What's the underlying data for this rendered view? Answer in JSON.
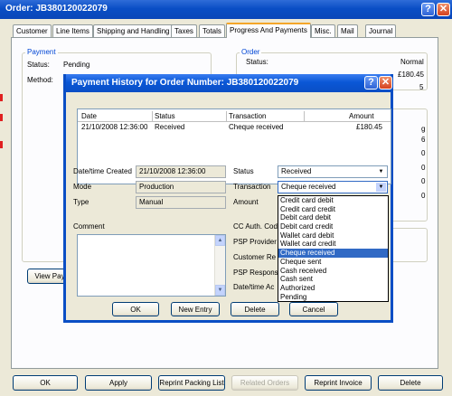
{
  "window": {
    "title": "Order: JB380120022079",
    "help_btn": "?",
    "close_btn": "✕"
  },
  "tabs": [
    "Customer",
    "Line Items",
    "Shipping and Handling",
    "Taxes",
    "Totals",
    "Progress And Payments",
    "Misc.",
    "Mail",
    "Journal"
  ],
  "active_tab": "Progress And Payments",
  "payment_group": {
    "legend": "Payment",
    "status_label": "Status:",
    "status_value": "Pending",
    "method_label": "Method:"
  },
  "order_group": {
    "legend": "Order",
    "status_label": "Status:",
    "status_value": "Normal",
    "clip_a": "£180.45",
    "clip_b": "5"
  },
  "right_clip": [
    "g",
    "6",
    "0",
    "0",
    "0",
    "0"
  ],
  "view_payments_btn": "View Pay",
  "bottom_buttons": {
    "ok": "OK",
    "apply": "Apply",
    "reprint_packing": "Reprint Packing List",
    "related_orders": "Related Orders",
    "reprint_invoice": "Reprint Invoice",
    "delete": "Delete"
  },
  "dialog": {
    "title": "Payment History for Order Number: JB380120022079",
    "help_btn": "?",
    "close_btn": "✕",
    "history": {
      "columns": [
        "Date",
        "Status",
        "Transaction",
        "Amount"
      ],
      "rows": [
        {
          "date": "21/10/2008 12:36:00",
          "status": "Received",
          "transaction": "Cheque received",
          "amount": "£180.45"
        }
      ]
    },
    "fields": {
      "datetime_label": "Date/time Created",
      "datetime_value": "21/10/2008 12:36:00",
      "mode_label": "Mode",
      "mode_value": "Production",
      "type_label": "Type",
      "type_value": "Manual",
      "status_label": "Status",
      "status_value": "Received",
      "transaction_label": "Transaction",
      "transaction_value": "Cheque received",
      "amount_label": "Amount",
      "comment_label": "Comment",
      "cc_auth_label": "CC Auth. Cod",
      "psp_provider_label": "PSP Provider",
      "customer_ref_label": "Customer Re",
      "psp_response_label": "PSP Respons",
      "datetime_ack_label": "Date/time Ac"
    },
    "transaction_options": [
      "Credit card debit",
      "Credit card credit",
      "Debit card debit",
      "Debit card credit",
      "Wallet card debit",
      "Wallet card credit",
      "Cheque received",
      "Cheque sent",
      "Cash received",
      "Cash sent",
      "Authorized",
      "Pending"
    ],
    "selected_option": "Cheque received",
    "buttons": {
      "ok": "OK",
      "new_entry": "New Entry",
      "delete": "Delete",
      "cancel": "Cancel"
    }
  },
  "colors": {
    "titlebar": "#0a4ec5",
    "selection": "#316ac5",
    "tab_highlight": "#f4a62a",
    "group_legend": "#0046d5"
  }
}
